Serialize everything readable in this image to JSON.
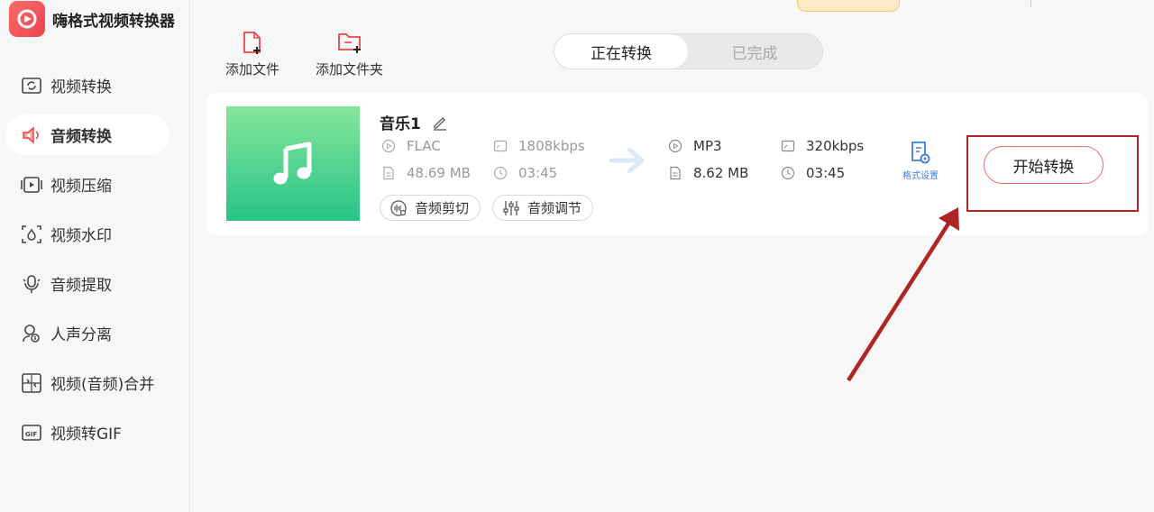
{
  "app": {
    "title": "嗨格式视频转换器"
  },
  "sidebar": {
    "items": [
      {
        "label": "视频转换",
        "icon": "video-convert-icon",
        "active": false
      },
      {
        "label": "音频转换",
        "icon": "audio-convert-icon",
        "active": true
      },
      {
        "label": "视频压缩",
        "icon": "video-compress-icon",
        "active": false
      },
      {
        "label": "视频水印",
        "icon": "video-watermark-icon",
        "active": false
      },
      {
        "label": "音频提取",
        "icon": "audio-extract-icon",
        "active": false
      },
      {
        "label": "人声分离",
        "icon": "vocal-separate-icon",
        "active": false
      },
      {
        "label": "视频(音频)合并",
        "icon": "merge-icon",
        "active": false
      },
      {
        "label": "视频转GIF",
        "icon": "gif-icon",
        "active": false
      }
    ]
  },
  "toolbar": {
    "add_file": "添加文件",
    "add_folder": "添加文件夹"
  },
  "tabs": {
    "converting": "正在转换",
    "completed": "已完成"
  },
  "task": {
    "name": "音乐1",
    "source": {
      "format": "FLAC",
      "bitrate": "1808kbps",
      "size": "48.69 MB",
      "duration": "03:45"
    },
    "target": {
      "format": "MP3",
      "bitrate": "320kbps",
      "size": "8.62 MB",
      "duration": "03:45"
    },
    "actions": {
      "trim": "音频剪切",
      "adjust": "音频调节",
      "format_settings": "格式设置",
      "start": "开始转换"
    }
  },
  "colors": {
    "accent": "#e8454b",
    "annotation": "#b02424",
    "thumb_top": "#86e59a",
    "thumb_bottom": "#27c488",
    "link_blue": "#3b7ee5"
  }
}
